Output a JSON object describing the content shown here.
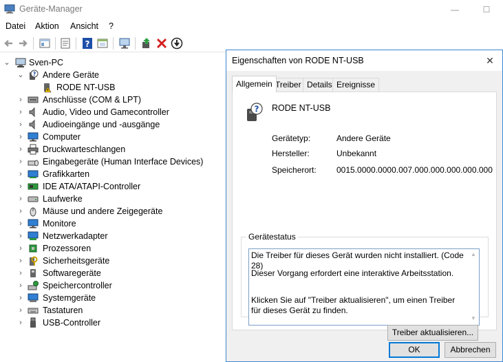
{
  "window": {
    "title": "Geräte-Manager",
    "controls": {
      "minimize": "—",
      "maximize": "☐"
    }
  },
  "menu": [
    "Datei",
    "Aktion",
    "Ansicht",
    "?"
  ],
  "toolbar": {
    "buttons": [
      "back-icon",
      "forward-icon",
      "show-hide-tree-icon",
      "properties-icon",
      "help-icon",
      "view-icon",
      "scan-hardware-icon",
      "update-driver-icon",
      "uninstall-icon",
      "disable-icon"
    ]
  },
  "tree": {
    "root": "Sven-PC",
    "expanded_group": "Andere Geräte",
    "expanded_child": "RODE NT-USB",
    "categories": [
      "Anschlüsse (COM & LPT)",
      "Audio, Video und Gamecontroller",
      "Audioeingänge und -ausgänge",
      "Computer",
      "Druckwarteschlangen",
      "Eingabegeräte (Human Interface Devices)",
      "Grafikkarten",
      "IDE ATA/ATAPI-Controller",
      "Laufwerke",
      "Mäuse und andere Zeigegeräte",
      "Monitore",
      "Netzwerkadapter",
      "Prozessoren",
      "Sicherheitsgeräte",
      "Softwaregeräte",
      "Speichercontroller",
      "Systemgeräte",
      "Tastaturen",
      "USB-Controller"
    ]
  },
  "dialog": {
    "title": "Eigenschaften von RODE NT-USB",
    "close": "✕",
    "tabs": [
      "Allgemein",
      "Treiber",
      "Details",
      "Ereignisse"
    ],
    "active_tab": "Allgemein",
    "device_name": "RODE NT-USB",
    "properties": {
      "type_label": "Gerätetyp:",
      "type_value": "Andere Geräte",
      "manufacturer_label": "Hersteller:",
      "manufacturer_value": "Unbekannt",
      "location_label": "Speicherort:",
      "location_value": "0015.0000.0000.007.000.000.000.000.000"
    },
    "status": {
      "legend": "Gerätestatus",
      "line1": "Die Treiber für dieses Gerät wurden nicht installiert. (Code 28)",
      "line2": "Dieser Vorgang erfordert eine interaktive Arbeitsstation.",
      "line3": "Klicken Sie auf \"Treiber aktualisieren\", um einen Treiber für dieses Gerät zu finden."
    },
    "update_driver_button": "Treiber aktualisieren...",
    "ok_button": "OK",
    "cancel_button": "Abbrechen"
  },
  "colors": {
    "dialog_border": "#3c86d3",
    "accent": "#0078d7",
    "warning": "#f2c200",
    "error_x": "#d42020"
  }
}
